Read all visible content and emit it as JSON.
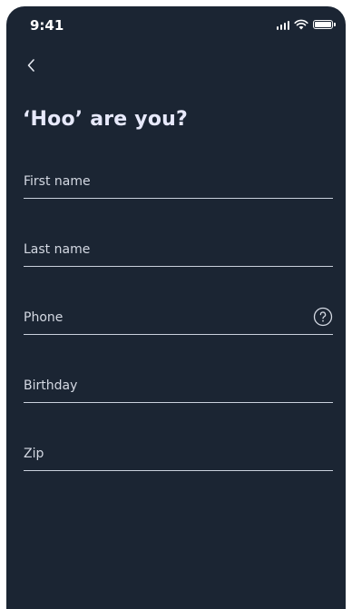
{
  "status_bar": {
    "time": "9:41",
    "icons": [
      "signal-icon",
      "wifi-icon",
      "battery-icon"
    ]
  },
  "nav": {
    "back_icon": "chevron-left-icon"
  },
  "page": {
    "title": "‘Hoo’ are you?"
  },
  "form": {
    "fields": [
      {
        "name": "first-name",
        "placeholder": "First name",
        "value": ""
      },
      {
        "name": "last-name",
        "placeholder": "Last name",
        "value": ""
      },
      {
        "name": "phone",
        "placeholder": "Phone",
        "value": "",
        "help_icon": "question-circle-icon"
      },
      {
        "name": "birthday",
        "placeholder": "Birthday",
        "value": ""
      },
      {
        "name": "zip",
        "placeholder": "Zip",
        "value": ""
      }
    ]
  },
  "colors": {
    "background": "#1b2533",
    "text": "#e7eaf2",
    "underline": "#c9d0dc"
  }
}
